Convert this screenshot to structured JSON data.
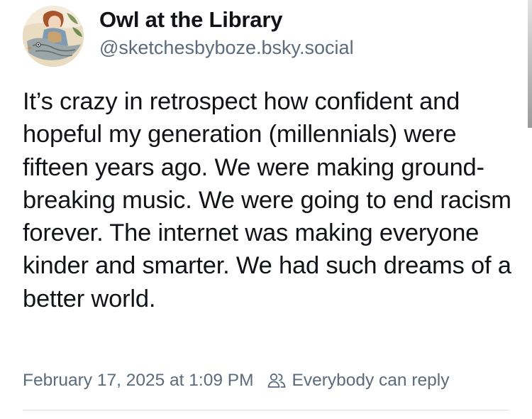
{
  "author": {
    "display_name": "Owl at the Library",
    "handle": "@sketchesbyboze.bsky.social",
    "avatar_icon": "illustrated-avatar"
  },
  "post": {
    "text": "It’s crazy in retrospect how confident and hopeful my generation (millennials) were fifteen years ago. We were making ground-breaking music. We were going to end racism forever. The internet was making everyone kinder and smarter. We had such dreams of a better world.",
    "timestamp": "February 17, 2025 at 1:09 PM",
    "reply_setting": "Everybody can reply",
    "reply_setting_icon": "people-icon"
  },
  "colors": {
    "text": "#111318",
    "secondary_text": "#5b6b7e",
    "divider": "#d6dde5",
    "background": "#ffffff"
  }
}
